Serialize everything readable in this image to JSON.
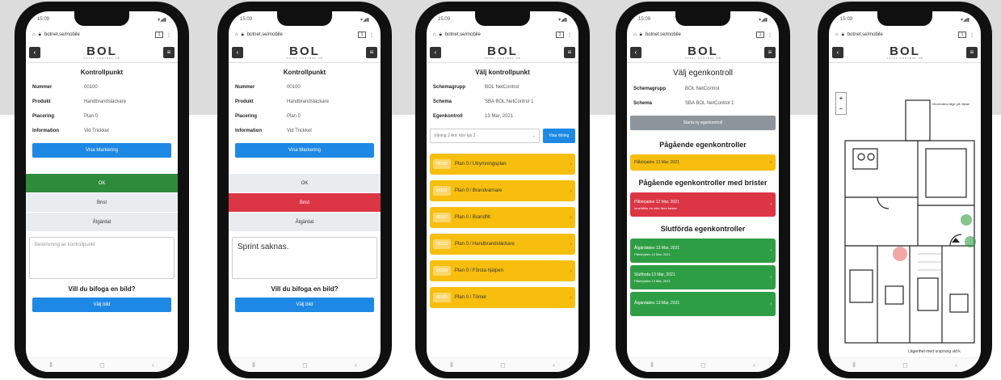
{
  "common": {
    "url": "botnet.se/mobile",
    "logo": "BOL",
    "logo_sub": "TOTAL CONTROL AB",
    "menu_icon": "hamburger-icon",
    "back_icon": "back-arrow-icon"
  },
  "phone1": {
    "title": "Kontrollpunkt",
    "rows": [
      {
        "k": "Nummer",
        "v": "00100"
      },
      {
        "k": "Produkt",
        "v": "Handbrandsläckare"
      },
      {
        "k": "Placering",
        "v": "Plan 0"
      },
      {
        "k": "Information",
        "v": "Vid Trickket"
      }
    ],
    "show_marking": "Visa Markering",
    "ok": "OK",
    "defect": "Brist",
    "other": "Åtgärdat",
    "comment_placeholder": "Beskrivning av kontrollpunkt",
    "attach_question": "Vill du bifoga en bild?",
    "attach_button": "Välj bild"
  },
  "phone2": {
    "title": "Kontrollpunkt",
    "rows": [
      {
        "k": "Nummer",
        "v": "00100"
      },
      {
        "k": "Produkt",
        "v": "Handbrandsläckare"
      },
      {
        "k": "Placering",
        "v": "Plan 0"
      },
      {
        "k": "Information",
        "v": "Vid Trickket"
      }
    ],
    "show_marking": "Visa Markering",
    "ok": "OK",
    "defect": "Brist",
    "other": "Åtgärdat",
    "comment_value": "Sprint saknas.",
    "attach_question": "Vill du bifoga en bild?",
    "attach_button": "Välj bild"
  },
  "phone3": {
    "title": "Välj kontrollpunkt",
    "rows": [
      {
        "k": "Schemagrupp",
        "v": "BOL NetControl"
      },
      {
        "k": "Schema",
        "v": "SBA BOL NetControl 1"
      },
      {
        "k": "Egenkontroll",
        "v": "13 Mar, 2021"
      }
    ],
    "select_value": "Våning 2 Ant. kön typ 2",
    "select_button": "Visa ritning",
    "items": [
      {
        "code": "00100",
        "text": "Plan 0 / Utrymningsplan"
      },
      {
        "code": "00101",
        "text": "Plan 0 / Brandvarnare"
      },
      {
        "code": "00102",
        "text": "Plan 0 / Brandfilt"
      },
      {
        "code": "00103",
        "text": "Plan 0 / Handbrandsläckare"
      },
      {
        "code": "00104",
        "text": "Plan 0 / Första hjälpen"
      },
      {
        "code": "00105",
        "text": "Plan 0 / Tömer"
      }
    ]
  },
  "phone4": {
    "title": "Välj egenkontroll",
    "rows": [
      {
        "k": "Schemagrupp",
        "v": "BOL NetControl"
      },
      {
        "k": "Schema",
        "v": "SBA BOL NetControl 1"
      }
    ],
    "start_button": "Starta ny egenkontroll",
    "ongoing_title": "Pågående egenkontroller",
    "ongoing_item": "Påbörjades 13 Mar, 2021",
    "defects_title": "Pågående egenkontroller med brister",
    "defects_item_1": "Påbörjades 12 Mar, 2021",
    "defects_item_2": "Innehåller en eller flera brister",
    "done_title": "Slutförda egenkontroller",
    "done_items": [
      {
        "a": "Åtgärdades 13 Mar, 2021",
        "b": "Påbörjades 12 Mar, 2021"
      },
      {
        "a": "Slutförda 13 Mar, 2021",
        "b": "Påbörjades 13 Mar, 2021"
      },
      {
        "a": "Åtgärdades 13 Mar, 2021",
        "b": ""
      }
    ]
  },
  "phone5": {
    "zoom_in": "+",
    "zoom_out": "−",
    "note_top": "Information läge på ritplan",
    "bottom_label": "Lägenhet med ursprung vid k"
  }
}
